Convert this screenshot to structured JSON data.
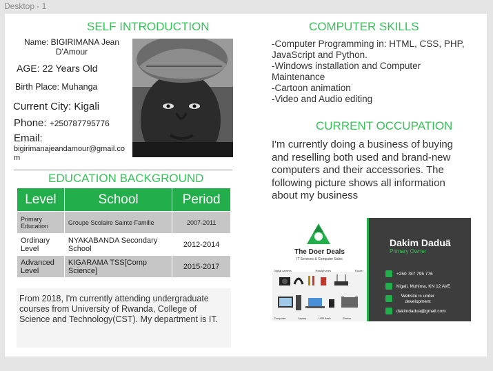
{
  "frame": {
    "label": "Desktop - 1"
  },
  "intro": {
    "title": "SELF INTRODUCTION",
    "name": "Name: BIGIRIMANA Jean D'Amour",
    "age": "AGE: 22 Years Old",
    "birth_place": "Birth Place: Muhanga",
    "current_city": "Current City: Kigali",
    "phone_label": "Phone: ",
    "phone_value": "+250787795776",
    "email_label": "Email:",
    "email_value": "bigirimanajeandamour@gmail.com"
  },
  "education": {
    "title": "EDUCATION BACKGROUND",
    "headers": [
      "Level",
      "School",
      "Period"
    ],
    "rows": [
      {
        "level": "Primary Education",
        "school": "Groupe Scolaire Sainte Famille",
        "period": "2007-2011"
      },
      {
        "level": "Ordinary Level",
        "school": "NYAKABANDA Secondary School",
        "period": "2012-2014"
      },
      {
        "level": "Advanced Level",
        "school": "KIGARAMA TSS[Comp Science]",
        "period": "2015-2017"
      }
    ],
    "note": "From 2018, I'm currently attending undergraduate courses from University of Rwanda, College of Science and Technology(CST). My department is IT."
  },
  "skills": {
    "title": "COMPUTER SKILLS",
    "items": [
      "-Computer Programming in: HTML, CSS, PHP, JavaScript and Python.",
      "-Windows installation and Computer Maintenance",
      "-Cartoon animation",
      "-Video and Audio editing"
    ]
  },
  "occupation": {
    "title": "CURRENT OCCUPATION",
    "text": "I'm currently doing a business of buying and reselling both used and brand-new computers and their accessories. The following picture shows all information about my business"
  },
  "business_card": {
    "brand": "The Doer Deals",
    "tagline": "IT Services & Computer Sales",
    "owner_name": "Dakim Daduä",
    "owner_role": "Primary Owner",
    "phone": "+250 787 795 776",
    "address": "Kigali, Muhima, KN 12 AVE",
    "website": "Website is under development",
    "email": "dakimdadua@gmail.com",
    "products": [
      "Digital camera",
      "Headphones",
      "USB flash",
      "Router",
      "Computer",
      "Laptop",
      "Printer"
    ]
  },
  "colors": {
    "accent": "#38c15a",
    "table_header": "#22ae4b",
    "card_dark": "#3d3d3d"
  }
}
